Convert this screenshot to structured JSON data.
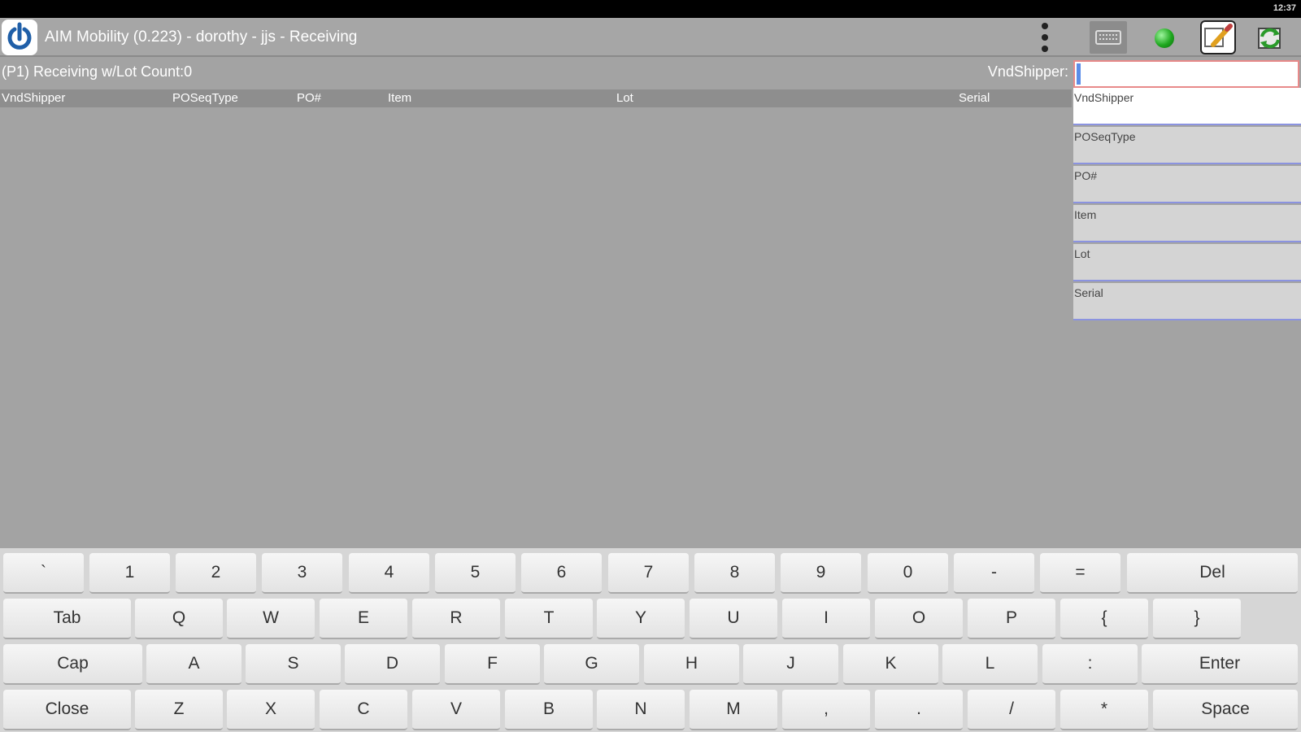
{
  "statusbar": {
    "time": "12:37"
  },
  "titlebar": {
    "title": "AIM Mobility (0.223) - dorothy - jjs - Receiving",
    "icons": [
      "app-logo",
      "overflow-menu-icon",
      "keyboard-icon",
      "status-dot-green",
      "edit-icon",
      "sync-icon"
    ],
    "status_color": "#1fa81f"
  },
  "infobar": {
    "screen_label": "(P1) Receiving w/Lot  Count:0",
    "vnd_label": "VndShipper:",
    "vnd_value": ""
  },
  "grid": {
    "columns": [
      "VndShipper",
      "POSeqType",
      "PO#",
      "Item",
      "Lot",
      "Serial"
    ],
    "rows": []
  },
  "side_panel": {
    "items": [
      "VndShipper",
      "POSeqType",
      "PO#",
      "Item",
      "Lot",
      "Serial"
    ]
  },
  "keyboard": {
    "rows": [
      [
        "`",
        "1",
        "2",
        "3",
        "4",
        "5",
        "6",
        "7",
        "8",
        "9",
        "0",
        "-",
        "=",
        "Del"
      ],
      [
        "Tab",
        "Q",
        "W",
        "E",
        "R",
        "T",
        "Y",
        "U",
        "I",
        "O",
        "P",
        "{",
        "}"
      ],
      [
        "Cap",
        "A",
        "S",
        "D",
        "F",
        "G",
        "H",
        "J",
        "K",
        "L",
        ":",
        "Enter"
      ],
      [
        "Close",
        "Z",
        "X",
        "C",
        "V",
        "B",
        "N",
        "M",
        ",",
        ".",
        "/",
        "*",
        "Space"
      ]
    ]
  }
}
